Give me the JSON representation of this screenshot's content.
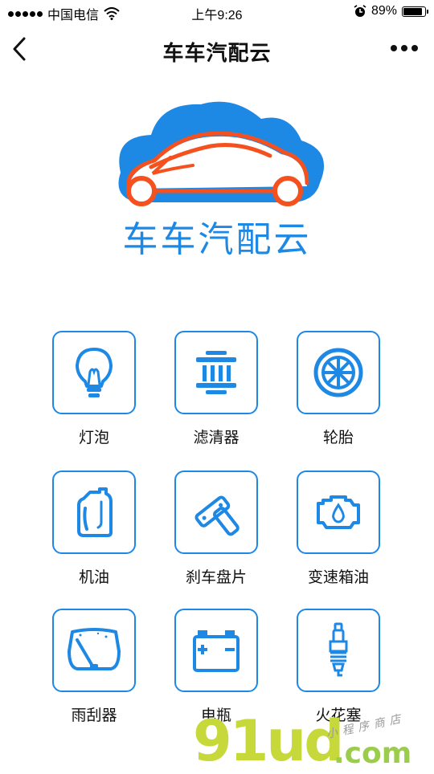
{
  "status_bar": {
    "carrier": "中国电信",
    "time": "上午9:26",
    "battery": "89%"
  },
  "nav": {
    "title": "车车汽配云"
  },
  "logo": {
    "text": "车车汽配云",
    "colors": {
      "cloud": "#1e88e5",
      "car": "#f4511e"
    }
  },
  "categories": [
    {
      "label": "灯泡",
      "icon": "light-bulb-icon"
    },
    {
      "label": "滤清器",
      "icon": "filter-icon"
    },
    {
      "label": "轮胎",
      "icon": "tire-icon"
    },
    {
      "label": "机油",
      "icon": "oil-bottle-icon"
    },
    {
      "label": "刹车盘片",
      "icon": "brake-pads-icon"
    },
    {
      "label": "变速箱油",
      "icon": "engine-oil-icon"
    },
    {
      "label": "雨刮器",
      "icon": "wiper-icon"
    },
    {
      "label": "电瓶",
      "icon": "battery-icon"
    },
    {
      "label": "火花塞",
      "icon": "spark-plug-icon"
    }
  ],
  "watermark": {
    "main": "91ud",
    "suffix": ".com",
    "small": "小程序商店"
  },
  "theme": {
    "accent": "#1e88e5"
  }
}
